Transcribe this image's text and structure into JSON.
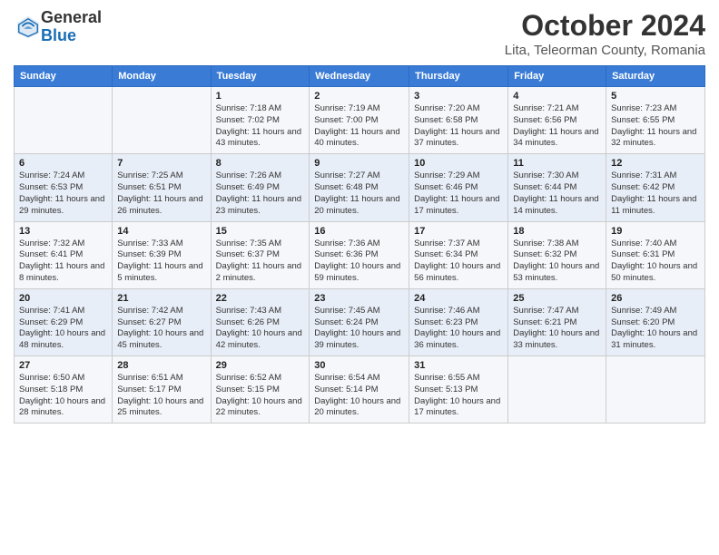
{
  "header": {
    "logo": {
      "general": "General",
      "blue": "Blue"
    },
    "title": "October 2024",
    "location": "Lita, Teleorman County, Romania"
  },
  "calendar": {
    "days_of_week": [
      "Sunday",
      "Monday",
      "Tuesday",
      "Wednesday",
      "Thursday",
      "Friday",
      "Saturday"
    ],
    "weeks": [
      [
        {
          "day": "",
          "info": ""
        },
        {
          "day": "",
          "info": ""
        },
        {
          "day": "1",
          "info": "Sunrise: 7:18 AM\nSunset: 7:02 PM\nDaylight: 11 hours and 43 minutes."
        },
        {
          "day": "2",
          "info": "Sunrise: 7:19 AM\nSunset: 7:00 PM\nDaylight: 11 hours and 40 minutes."
        },
        {
          "day": "3",
          "info": "Sunrise: 7:20 AM\nSunset: 6:58 PM\nDaylight: 11 hours and 37 minutes."
        },
        {
          "day": "4",
          "info": "Sunrise: 7:21 AM\nSunset: 6:56 PM\nDaylight: 11 hours and 34 minutes."
        },
        {
          "day": "5",
          "info": "Sunrise: 7:23 AM\nSunset: 6:55 PM\nDaylight: 11 hours and 32 minutes."
        }
      ],
      [
        {
          "day": "6",
          "info": "Sunrise: 7:24 AM\nSunset: 6:53 PM\nDaylight: 11 hours and 29 minutes."
        },
        {
          "day": "7",
          "info": "Sunrise: 7:25 AM\nSunset: 6:51 PM\nDaylight: 11 hours and 26 minutes."
        },
        {
          "day": "8",
          "info": "Sunrise: 7:26 AM\nSunset: 6:49 PM\nDaylight: 11 hours and 23 minutes."
        },
        {
          "day": "9",
          "info": "Sunrise: 7:27 AM\nSunset: 6:48 PM\nDaylight: 11 hours and 20 minutes."
        },
        {
          "day": "10",
          "info": "Sunrise: 7:29 AM\nSunset: 6:46 PM\nDaylight: 11 hours and 17 minutes."
        },
        {
          "day": "11",
          "info": "Sunrise: 7:30 AM\nSunset: 6:44 PM\nDaylight: 11 hours and 14 minutes."
        },
        {
          "day": "12",
          "info": "Sunrise: 7:31 AM\nSunset: 6:42 PM\nDaylight: 11 hours and 11 minutes."
        }
      ],
      [
        {
          "day": "13",
          "info": "Sunrise: 7:32 AM\nSunset: 6:41 PM\nDaylight: 11 hours and 8 minutes."
        },
        {
          "day": "14",
          "info": "Sunrise: 7:33 AM\nSunset: 6:39 PM\nDaylight: 11 hours and 5 minutes."
        },
        {
          "day": "15",
          "info": "Sunrise: 7:35 AM\nSunset: 6:37 PM\nDaylight: 11 hours and 2 minutes."
        },
        {
          "day": "16",
          "info": "Sunrise: 7:36 AM\nSunset: 6:36 PM\nDaylight: 10 hours and 59 minutes."
        },
        {
          "day": "17",
          "info": "Sunrise: 7:37 AM\nSunset: 6:34 PM\nDaylight: 10 hours and 56 minutes."
        },
        {
          "day": "18",
          "info": "Sunrise: 7:38 AM\nSunset: 6:32 PM\nDaylight: 10 hours and 53 minutes."
        },
        {
          "day": "19",
          "info": "Sunrise: 7:40 AM\nSunset: 6:31 PM\nDaylight: 10 hours and 50 minutes."
        }
      ],
      [
        {
          "day": "20",
          "info": "Sunrise: 7:41 AM\nSunset: 6:29 PM\nDaylight: 10 hours and 48 minutes."
        },
        {
          "day": "21",
          "info": "Sunrise: 7:42 AM\nSunset: 6:27 PM\nDaylight: 10 hours and 45 minutes."
        },
        {
          "day": "22",
          "info": "Sunrise: 7:43 AM\nSunset: 6:26 PM\nDaylight: 10 hours and 42 minutes."
        },
        {
          "day": "23",
          "info": "Sunrise: 7:45 AM\nSunset: 6:24 PM\nDaylight: 10 hours and 39 minutes."
        },
        {
          "day": "24",
          "info": "Sunrise: 7:46 AM\nSunset: 6:23 PM\nDaylight: 10 hours and 36 minutes."
        },
        {
          "day": "25",
          "info": "Sunrise: 7:47 AM\nSunset: 6:21 PM\nDaylight: 10 hours and 33 minutes."
        },
        {
          "day": "26",
          "info": "Sunrise: 7:49 AM\nSunset: 6:20 PM\nDaylight: 10 hours and 31 minutes."
        }
      ],
      [
        {
          "day": "27",
          "info": "Sunrise: 6:50 AM\nSunset: 5:18 PM\nDaylight: 10 hours and 28 minutes."
        },
        {
          "day": "28",
          "info": "Sunrise: 6:51 AM\nSunset: 5:17 PM\nDaylight: 10 hours and 25 minutes."
        },
        {
          "day": "29",
          "info": "Sunrise: 6:52 AM\nSunset: 5:15 PM\nDaylight: 10 hours and 22 minutes."
        },
        {
          "day": "30",
          "info": "Sunrise: 6:54 AM\nSunset: 5:14 PM\nDaylight: 10 hours and 20 minutes."
        },
        {
          "day": "31",
          "info": "Sunrise: 6:55 AM\nSunset: 5:13 PM\nDaylight: 10 hours and 17 minutes."
        },
        {
          "day": "",
          "info": ""
        },
        {
          "day": "",
          "info": ""
        }
      ]
    ]
  }
}
